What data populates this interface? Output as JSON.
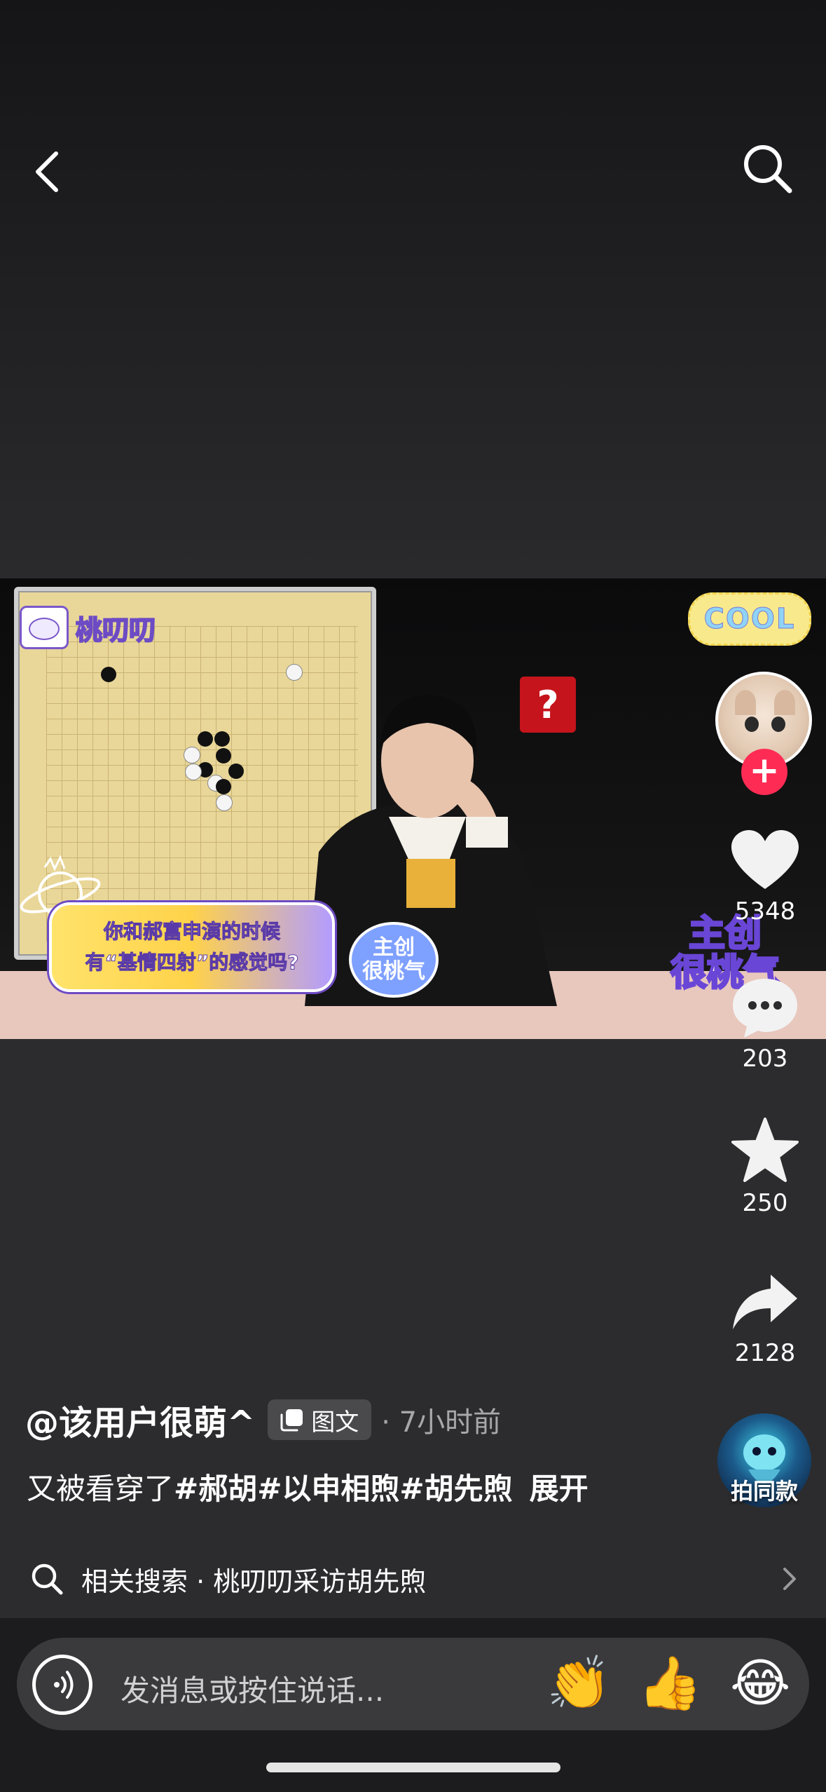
{
  "nav": {
    "back_icon": "chevron-left-icon",
    "search_icon": "search-icon"
  },
  "video": {
    "brand_text": "桃叨叨",
    "question_mark": "?",
    "cool_sticker": "COOL",
    "caption_line1": "你和郝富申演的时候",
    "caption_line2": "有“基情四射”的感觉吗?",
    "sticker_small_line1": "主创",
    "sticker_small_line2": "很桃气",
    "sticker_big_line1": "主创",
    "sticker_big_line2": "很桃气"
  },
  "actions": {
    "follow_label": "+",
    "likes": "5348",
    "comments": "203",
    "favorites": "250",
    "shares": "2128",
    "same_style_label": "拍同款"
  },
  "post": {
    "author": "@该用户很萌^",
    "type_badge": "图文",
    "time_ago": "· 7小时前",
    "desc_text": "又被看穿了",
    "desc_tags": "#郝胡#以申相煦#胡先煦",
    "expand_label": "展开"
  },
  "related": {
    "label": "相关搜索 · 桃叨叨采访胡先煦"
  },
  "composer": {
    "placeholder": "发消息或按住说话...",
    "emoji_1": "👏",
    "emoji_2": "👍",
    "emoji_3": "😂"
  },
  "colors": {
    "background": "#2c2c2e",
    "accent_follow": "#fe2c55",
    "muted_text": "#a8a8ab"
  }
}
